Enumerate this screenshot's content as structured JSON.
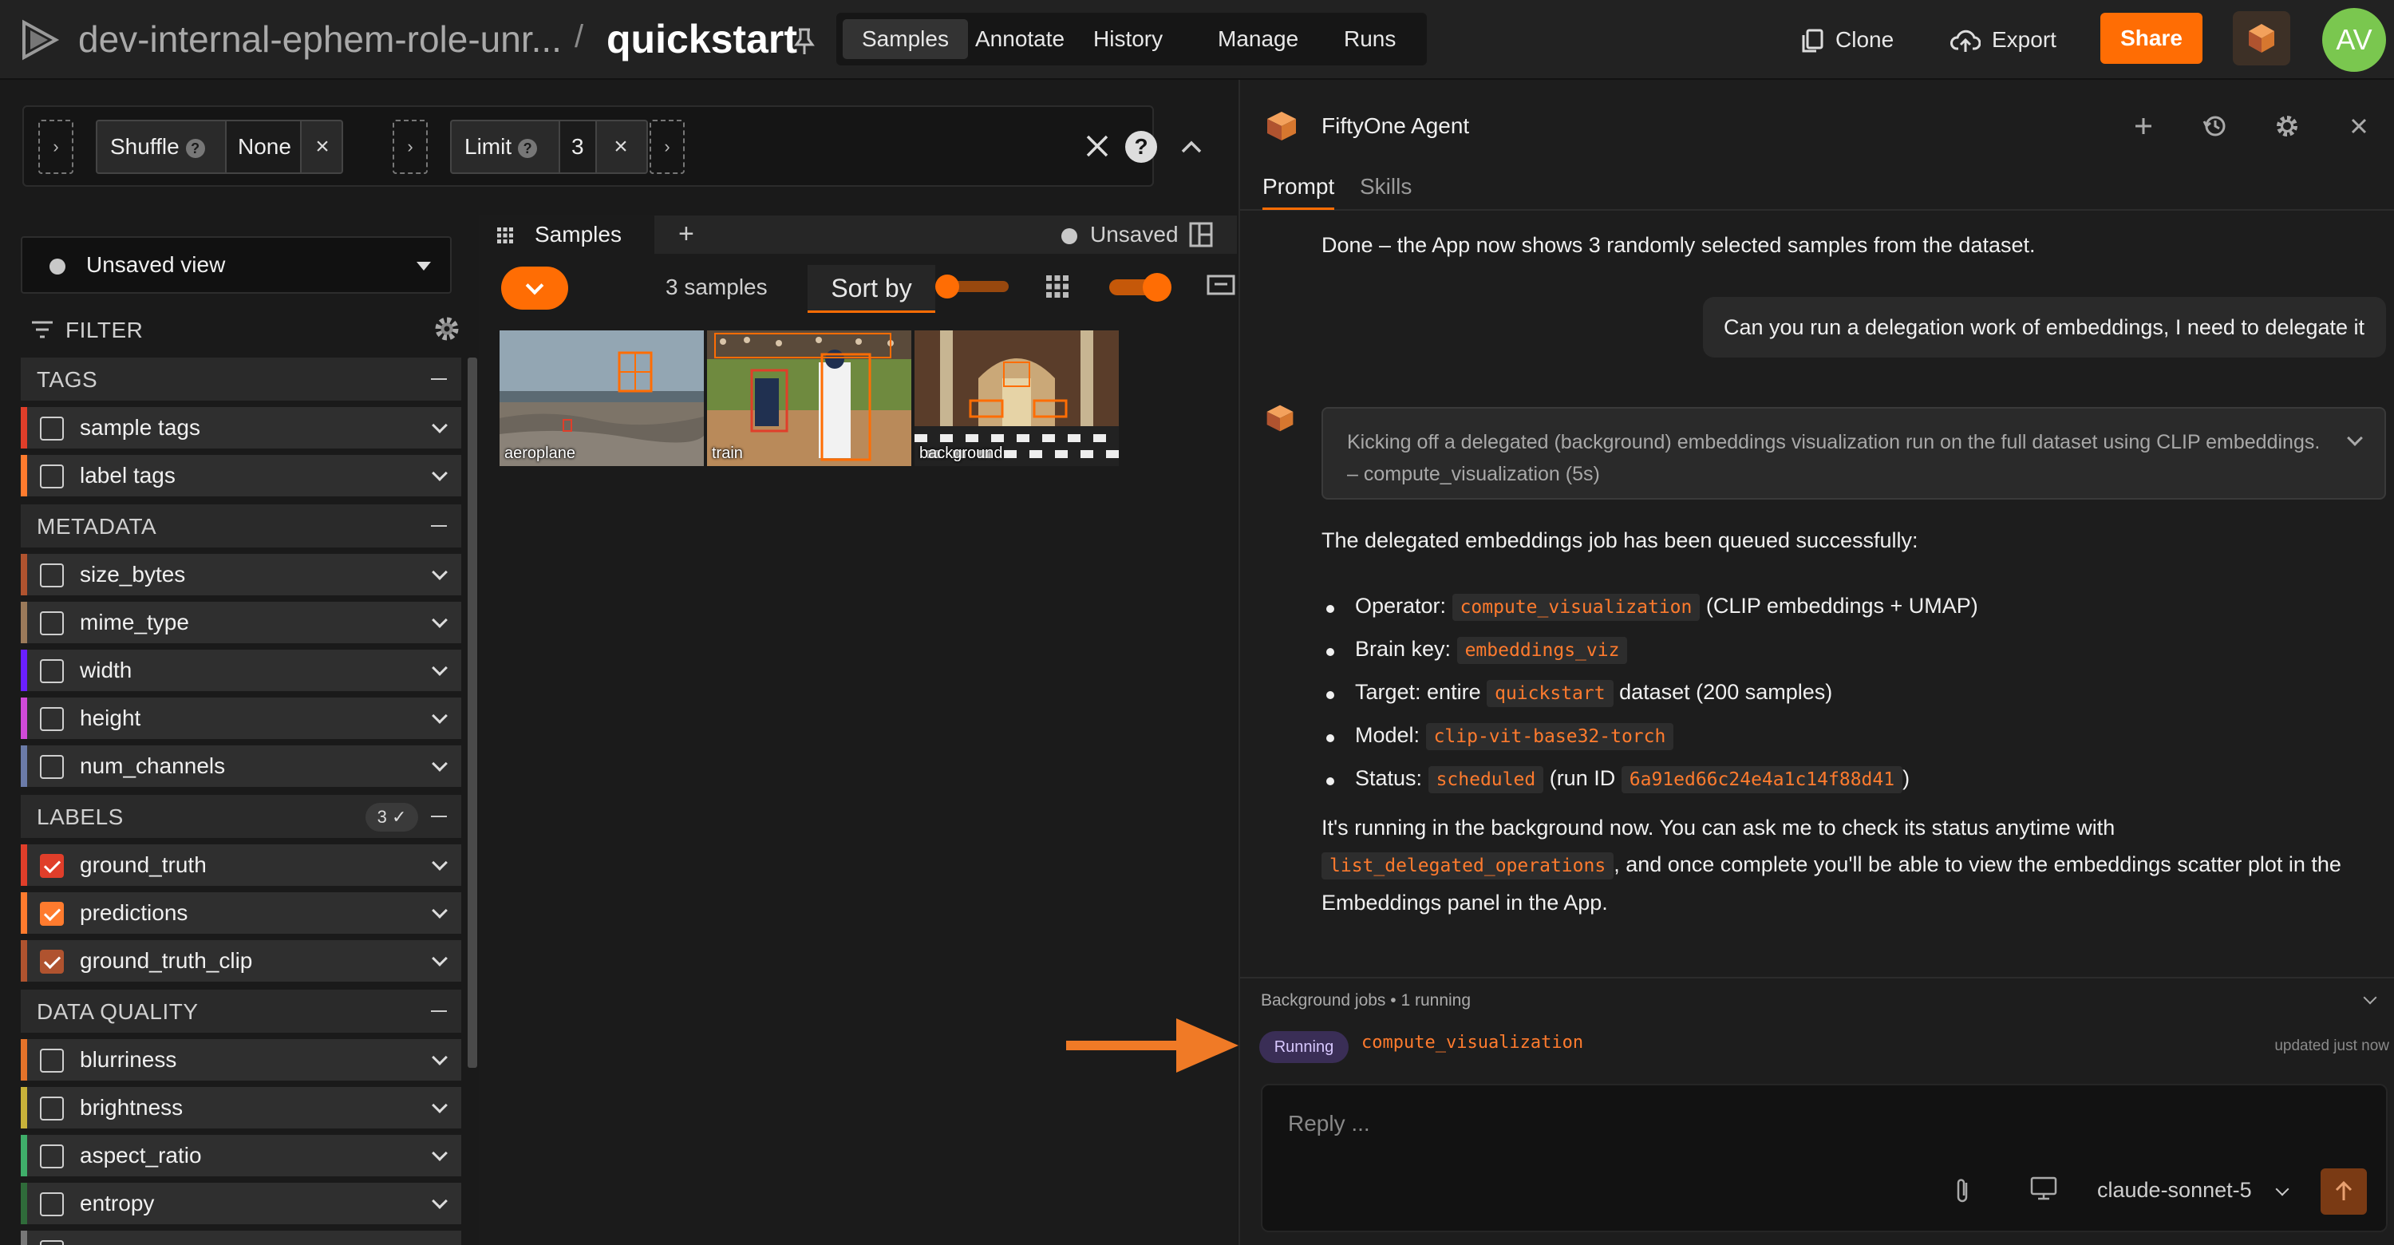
{
  "header": {
    "dataset_name": "dev-internal-ephem-role-unr...",
    "separator": "/",
    "dataset_title": "quickstart",
    "nav_tabs": [
      {
        "label": "Samples",
        "active": true
      },
      {
        "label": "Annotate",
        "active": false
      },
      {
        "label": "History",
        "active": false
      },
      {
        "label": "Manage",
        "active": false
      },
      {
        "label": "Runs",
        "active": false
      }
    ],
    "clone_label": "Clone",
    "export_label": "Export",
    "share_label": "Share",
    "avatar_initials": "AV",
    "accent_color": "#ff6d04"
  },
  "view_bar": {
    "stages": [
      {
        "label": "Shuffle",
        "help": "?",
        "value": "None",
        "remove": "×"
      },
      {
        "label": "Limit",
        "help": "?",
        "value": "3",
        "remove": "×"
      }
    ],
    "add_glyph": "›",
    "help_glyph": "?"
  },
  "sidebar": {
    "view_select": "Unsaved view",
    "filter_label": "FILTER",
    "sections": [
      {
        "title": "TAGS",
        "badge": "",
        "items": [
          {
            "name": "sample tags",
            "color": "#e03e2a",
            "checked": false
          },
          {
            "name": "label tags",
            "color": "#ff7b2e",
            "checked": false
          }
        ]
      },
      {
        "title": "METADATA",
        "badge": "",
        "items": [
          {
            "name": "size_bytes",
            "color": "#b0532f",
            "checked": false
          },
          {
            "name": "mime_type",
            "color": "#9b7a5a",
            "checked": false
          },
          {
            "name": "width",
            "color": "#6a1fff",
            "checked": false
          },
          {
            "name": "height",
            "color": "#d04ad8",
            "checked": false
          },
          {
            "name": "num_channels",
            "color": "#6b7ba8",
            "checked": false
          }
        ]
      },
      {
        "title": "LABELS",
        "badge": "3 ✓",
        "items": [
          {
            "name": "ground_truth",
            "color": "#e03e2a",
            "checked": true
          },
          {
            "name": "predictions",
            "color": "#ff7b2e",
            "checked": true
          },
          {
            "name": "ground_truth_clip",
            "color": "#b0532f",
            "checked": true
          }
        ]
      },
      {
        "title": "DATA QUALITY",
        "badge": "",
        "items": [
          {
            "name": "blurriness",
            "color": "#e5732a",
            "checked": false
          },
          {
            "name": "brightness",
            "color": "#c8b23a",
            "checked": false
          },
          {
            "name": "aspect_ratio",
            "color": "#3fae6a",
            "checked": false
          },
          {
            "name": "entropy",
            "color": "#2f6b3a",
            "checked": false
          }
        ]
      }
    ]
  },
  "grid": {
    "tab_label": "Samples",
    "add_tab": "+",
    "unsaved_label": "Unsaved",
    "count_label": "3 samples",
    "sort_label": "Sort by",
    "samples": [
      {
        "label": "aeroplane"
      },
      {
        "label": "train"
      },
      {
        "label": "background"
      }
    ]
  },
  "agent": {
    "title": "FiftyOne Agent",
    "tabs": [
      {
        "label": "Prompt",
        "active": true
      },
      {
        "label": "Skills",
        "active": false
      }
    ],
    "msg_done": "Done – the App now shows 3 randomly selected samples from the dataset.",
    "user_msg": "Can you run a delegation work of embeddings, I need to delegate it",
    "reasoning_line1": "Kicking off a delegated (background) embeddings visualization run on the full dataset using CLIP embeddings.",
    "reasoning_line2": "– compute_visualization (5s)",
    "msg_queued": "The delegated embeddings job has been queued successfully:",
    "bullets": {
      "operator_label": "Operator:",
      "operator_code": "compute_visualization",
      "operator_rest": "(CLIP embeddings + UMAP)",
      "brain_label": "Brain key:",
      "brain_code": "embeddings_viz",
      "target_label": "Target: entire",
      "target_code": "quickstart",
      "target_rest": "dataset (200 samples)",
      "model_label": "Model:",
      "model_code": "clip-vit-base32-torch",
      "status_label": "Status:",
      "status_code": "scheduled",
      "status_mid": "(run ID",
      "run_id": "6a91ed66c24e4a1c14f88d41",
      "status_end": ")"
    },
    "para1": "It's running in the background now. You can ask me to check its status anytime with",
    "para2_code": "list_delegated_operations",
    "para2_rest": ", and once complete you'll be able to view the embeddings scatter plot in the",
    "para3": "Embeddings panel in the App.",
    "jobs_label": "Background jobs • 1 running",
    "job_status": "Running",
    "job_name": "compute_visualization",
    "job_updated": "updated just now",
    "reply_placeholder": "Reply ...",
    "model_name": "claude-sonnet-5"
  }
}
